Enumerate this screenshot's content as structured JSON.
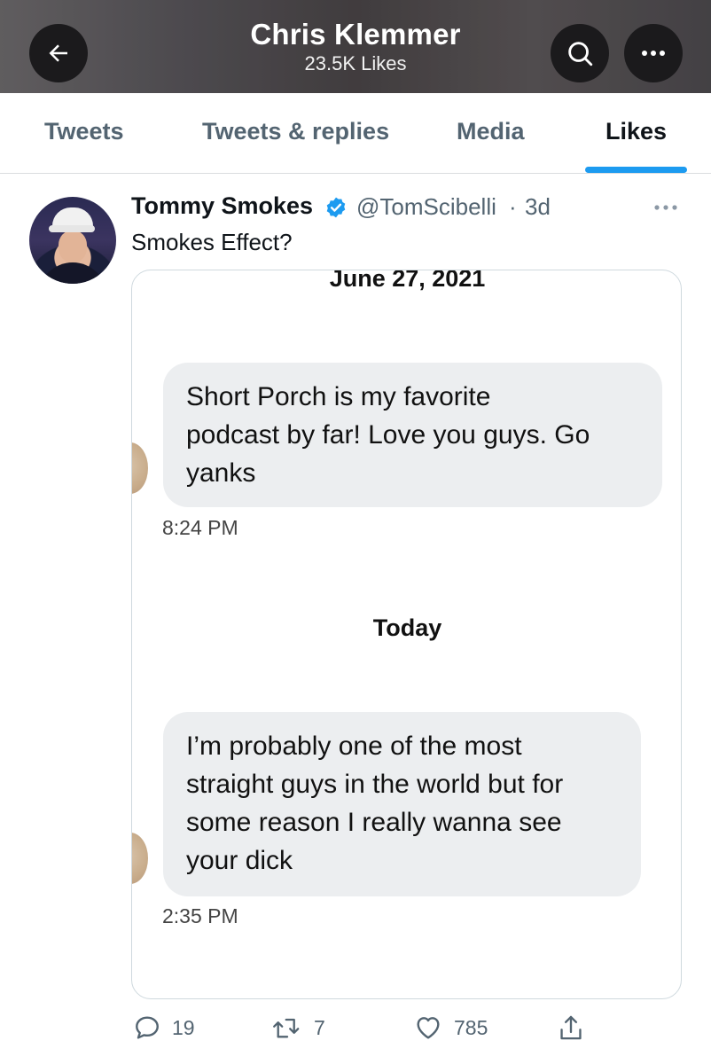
{
  "header": {
    "title": "Chris Klemmer",
    "subtitle": "23.5K Likes",
    "back_icon": "arrow-left-icon",
    "search_icon": "search-icon",
    "more_icon": "more-horizontal-icon"
  },
  "tabs": [
    {
      "label": "Tweets",
      "active": false
    },
    {
      "label": "Tweets & replies",
      "active": false
    },
    {
      "label": "Media",
      "active": false
    },
    {
      "label": "Likes",
      "active": true
    }
  ],
  "tweet": {
    "display_name": "Tommy Smokes",
    "verified": true,
    "handle": "@TomScibelli",
    "separator": "·",
    "time_ago": "3d",
    "text": "Smokes Effect?",
    "media": {
      "date_top": "June 27, 2021",
      "message1": {
        "lines": [
          "Short Porch is my favorite",
          "podcast by far! Love you guys. Go",
          "yanks"
        ],
        "time": "8:24 PM"
      },
      "date_mid": "Today",
      "message2": {
        "lines": [
          "I’m probably one of the most",
          "straight guys in the world but for",
          "some reason I really wanna see",
          "your dick"
        ],
        "time": "2:35 PM"
      }
    },
    "actions": {
      "replies": "19",
      "retweets": "7",
      "likes": "785"
    }
  },
  "colors": {
    "accent": "#1d9bf0",
    "secondary_text": "#536471",
    "bubble": "#eceef0"
  }
}
